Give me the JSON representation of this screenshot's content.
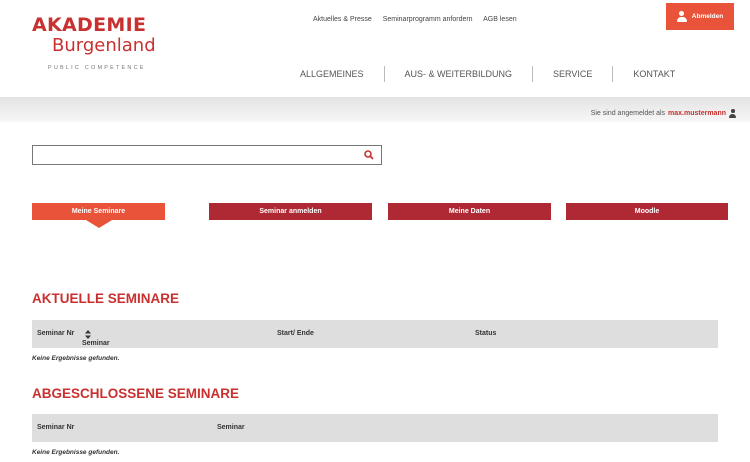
{
  "logo": {
    "line1": "AKADEMIE",
    "line2": "Burgenland",
    "tagline": "PUBLIC COMPETENCE"
  },
  "toplinks": [
    "Aktuelles & Presse",
    "Seminarprogramm anfordern",
    "AGB lesen"
  ],
  "logout": {
    "label": "Abmelden",
    "icon": "user-icon"
  },
  "mainnav": [
    "ALLGEMEINES",
    "AUS- & WEITERBILDUNG",
    "SERVICE",
    "KONTAKT"
  ],
  "login_status": {
    "prefix": "Sie sind angemeldet als",
    "user": "max.mustermann",
    "icon": "user-icon"
  },
  "search": {
    "value": "",
    "placeholder": "",
    "icon": "search-icon"
  },
  "tabs": [
    {
      "label": "Meine Seminare",
      "active": true
    },
    {
      "label": "Seminar anmelden",
      "active": false
    },
    {
      "label": "Meine Daten",
      "active": false
    },
    {
      "label": "Moodle",
      "active": false
    }
  ],
  "current": {
    "title": "AKTUELLE SEMINARE",
    "columns": [
      "Seminar Nr",
      "Seminar",
      "Start/ Ende",
      "Status"
    ],
    "sort_icon": "sort-icon",
    "empty": "Keine Ergebnisse gefunden."
  },
  "completed": {
    "title": "ABGESCHLOSSENE SEMINARE",
    "columns": [
      "Seminar Nr",
      "Seminar"
    ],
    "empty": "Keine Ergebnisse gefunden."
  },
  "colors": {
    "brand_red": "#c8312f",
    "active_tab": "#e8533a",
    "tab": "#ae2933",
    "table_header": "#dedede"
  }
}
